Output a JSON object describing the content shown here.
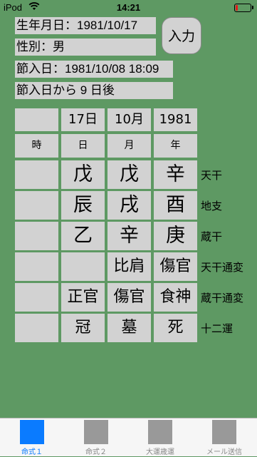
{
  "status": {
    "carrier": "iPod",
    "time": "14:21"
  },
  "info": {
    "birthdate": "生年月日：1981/10/17",
    "gender": "性別：男",
    "setsuiri": "節入日：1981/10/08 18:09",
    "since": "節入日から 9 日後",
    "input_button": "入力"
  },
  "table": {
    "top": [
      "",
      "17日",
      "10月",
      "1981"
    ],
    "header": [
      "時",
      "日",
      "月",
      "年"
    ],
    "rows": [
      {
        "cells": [
          "",
          "戊",
          "戊",
          "辛"
        ],
        "label": "天干"
      },
      {
        "cells": [
          "",
          "辰",
          "戌",
          "酉"
        ],
        "label": "地支"
      },
      {
        "cells": [
          "",
          "乙",
          "辛",
          "庚"
        ],
        "label": "蔵干"
      },
      {
        "cells": [
          "",
          "",
          "比肩",
          "傷官"
        ],
        "label": "天干通変"
      },
      {
        "cells": [
          "",
          "正官",
          "傷官",
          "食神"
        ],
        "label": "蔵干通変"
      },
      {
        "cells": [
          "",
          "冠",
          "墓",
          "死"
        ],
        "label": "十二運"
      }
    ]
  },
  "tabs": [
    {
      "label": "命式１",
      "active": true
    },
    {
      "label": "命式２",
      "active": false
    },
    {
      "label": "大運歳運",
      "active": false
    },
    {
      "label": "メール送信",
      "active": false
    }
  ],
  "colors": {
    "background": "#5e9963",
    "cell": "#d2d2d2",
    "active_tab": "#0a7bff"
  }
}
